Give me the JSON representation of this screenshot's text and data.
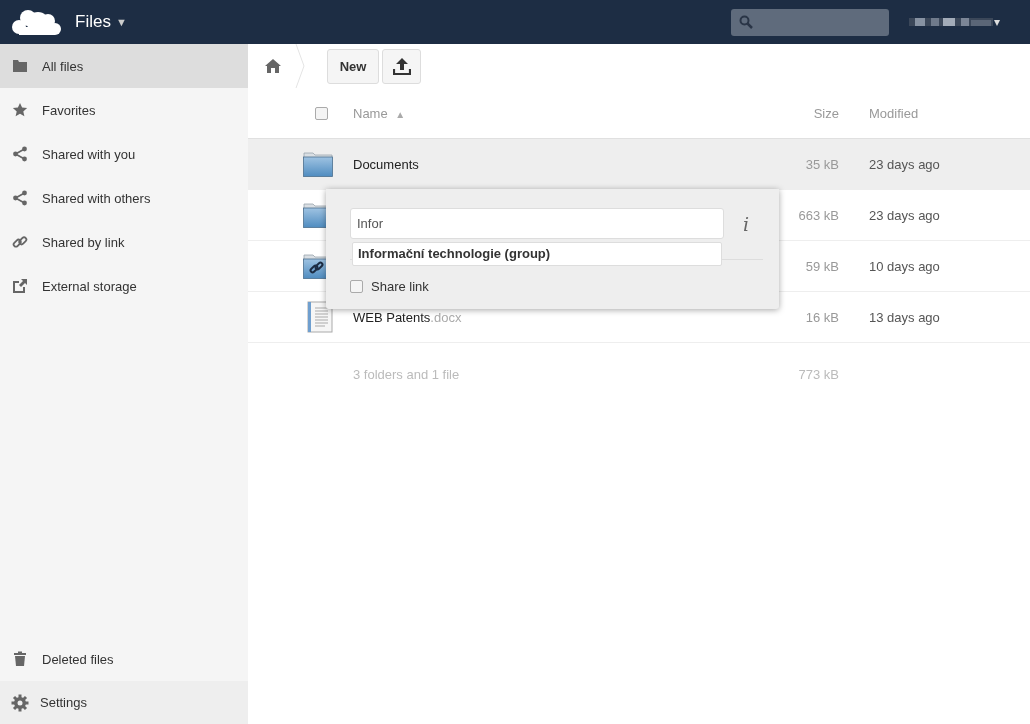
{
  "header": {
    "app_title": "Files",
    "app_caret": "▼",
    "user_caret": "▾"
  },
  "sidebar": {
    "items": [
      {
        "label": "All files",
        "kind": "folder",
        "selected": true
      },
      {
        "label": "Favorites",
        "kind": "star",
        "selected": false
      },
      {
        "label": "Shared with you",
        "kind": "share",
        "selected": false
      },
      {
        "label": "Shared with others",
        "kind": "share",
        "selected": false
      },
      {
        "label": "Shared by link",
        "kind": "link",
        "selected": false
      },
      {
        "label": "External storage",
        "kind": "external",
        "selected": false
      }
    ],
    "bottom_items": [
      {
        "label": "Deleted files",
        "kind": "trash",
        "selected": false
      }
    ],
    "settings": {
      "label": "Settings"
    }
  },
  "toolbar": {
    "new_button": "New"
  },
  "table": {
    "select_all": {
      "checked": false
    },
    "columns": {
      "name": "Name",
      "sort_indicator": "▲",
      "size": "Size",
      "modified": "Modified"
    },
    "rows": [
      {
        "kind": "folder",
        "name": "Documents",
        "size": "35 kB",
        "modified": "23 days ago",
        "selected": true
      },
      {
        "kind": "folder",
        "size": "663 kB",
        "modified": "23 days ago",
        "selected": false
      },
      {
        "kind": "shared-folder",
        "size": "59 kB",
        "modified": "10 days ago",
        "selected": false
      },
      {
        "kind": "document",
        "name": "WEB Patents",
        "extension": ".docx",
        "size": "16 kB",
        "modified": "13 days ago",
        "selected": false
      }
    ],
    "summary": {
      "text": "3 folders and 1 file",
      "size": "773 kB"
    }
  },
  "share_popover": {
    "input_value": "Infor",
    "info": "i",
    "suggestion": "Informační technologie (group)",
    "share_link": {
      "label": "Share link",
      "checked": false
    }
  }
}
